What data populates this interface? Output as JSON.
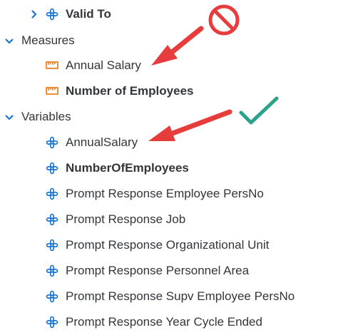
{
  "tree": {
    "valid_to": "Valid To",
    "measures": {
      "label": "Measures",
      "items": [
        "Annual Salary",
        "Number of Employees"
      ]
    },
    "variables": {
      "label": "Variables",
      "items": [
        "AnnualSalary",
        "NumberOfEmployees",
        "Prompt Response Employee PersNo",
        "Prompt Response Job",
        "Prompt Response Organizational Unit",
        "Prompt Response Personnel Area",
        "Prompt Response Supv Employee PersNo",
        "Prompt Response Year Cycle Ended"
      ]
    }
  },
  "icons": {
    "chevron_right": "chevron-right-icon",
    "chevron_down": "chevron-down-icon",
    "dimension": "dimension-icon",
    "measure": "measure-icon",
    "prohibited": "prohibited-icon",
    "checkmark": "checkmark-icon",
    "arrow": "arrow-icon"
  },
  "colors": {
    "text": "#32363a",
    "chevron": "#0a6ed1",
    "dimension_icon": "#0a6ed1",
    "measure_icon": "#e9730c",
    "arrow": "#e73c3c",
    "prohibited": "#e73c3c",
    "checkmark": "#2ba38a"
  }
}
